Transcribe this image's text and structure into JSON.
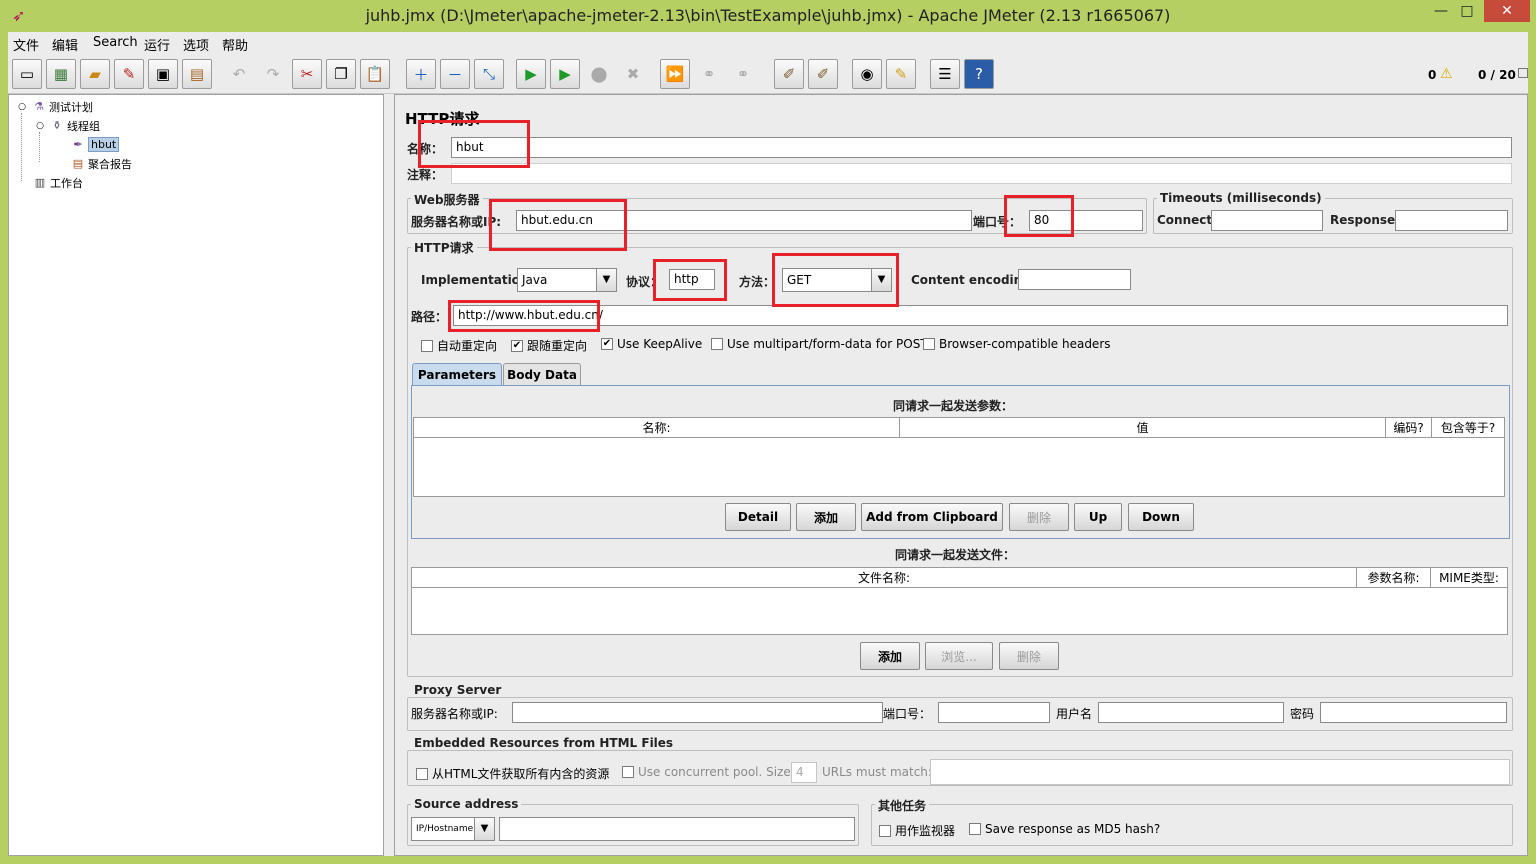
{
  "window": {
    "title": "juhb.jmx (D:\\Jmeter\\apache-jmeter-2.13\\bin\\TestExample\\juhb.jmx) - Apache JMeter (2.13 r1665067)",
    "min": "—",
    "max": "□",
    "close": "✕"
  },
  "menu": [
    "文件",
    "编辑",
    "Search",
    "运行",
    "选项",
    "帮助"
  ],
  "toolbar": {
    "warnings": "0",
    "threads": "0 / 20"
  },
  "tree": {
    "plan": "测试计划",
    "thread_group": "线程组",
    "sampler": "hbut",
    "report": "聚合报告",
    "workbench": "工作台"
  },
  "sampler": {
    "heading": "HTTP请求",
    "name_label": "名称：",
    "name_value": "hbut",
    "comment_label": "注释：",
    "web_server_legend": "Web服务器",
    "server_label": "服务器名称或IP:",
    "server_value": "hbut.edu.cn",
    "port_label": "端口号：",
    "port_value": "80",
    "timeouts_legend": "Timeouts (milliseconds)",
    "connect_label": "Connect:",
    "response_label": "Response:",
    "http_legend": "HTTP请求",
    "impl_label": "Implementation:",
    "impl_value": "Java",
    "protocol_label": "协议：",
    "protocol_value": "http",
    "method_label": "方法：",
    "method_value": "GET",
    "encoding_label": "Content encoding:",
    "path_label": "路径：",
    "path_value": "http://www.hbut.edu.cn/",
    "checkboxes": [
      {
        "label": "自动重定向",
        "checked": false
      },
      {
        "label": "跟随重定向",
        "checked": true
      },
      {
        "label": "Use KeepAlive",
        "checked": true
      },
      {
        "label": "Use multipart/form-data for POST",
        "checked": false
      },
      {
        "label": "Browser-compatible headers",
        "checked": false
      }
    ],
    "tabs": [
      "Parameters",
      "Body Data"
    ],
    "params_title": "同请求一起发送参数：",
    "params_columns": [
      "名称:",
      "值",
      "编码?",
      "包含等于?"
    ],
    "param_buttons": [
      "Detail",
      "添加",
      "Add from Clipboard",
      "删除",
      "Up",
      "Down"
    ],
    "files_title": "同请求一起发送文件：",
    "files_columns": [
      "文件名称:",
      "参数名称:",
      "MIME类型:"
    ],
    "file_buttons": [
      "添加",
      "浏览...",
      "删除"
    ],
    "proxy_legend": "Proxy Server",
    "proxy_server_label": "服务器名称或IP:",
    "proxy_port_label": "端口号：",
    "proxy_user_label": "用户名",
    "proxy_pass_label": "密码",
    "embedded_legend": "Embedded Resources from HTML Files",
    "embedded_cb": "从HTML文件获取所有内含的资源",
    "pool_cb": "Use concurrent pool. Size:",
    "pool_size": "4",
    "urls_label": "URLs must match:",
    "source_legend": "Source address",
    "source_type": "IP/Hostname",
    "other_legend": "其他任务",
    "monitor_cb": "用作监视器",
    "md5_cb": "Save response as MD5 hash?"
  }
}
